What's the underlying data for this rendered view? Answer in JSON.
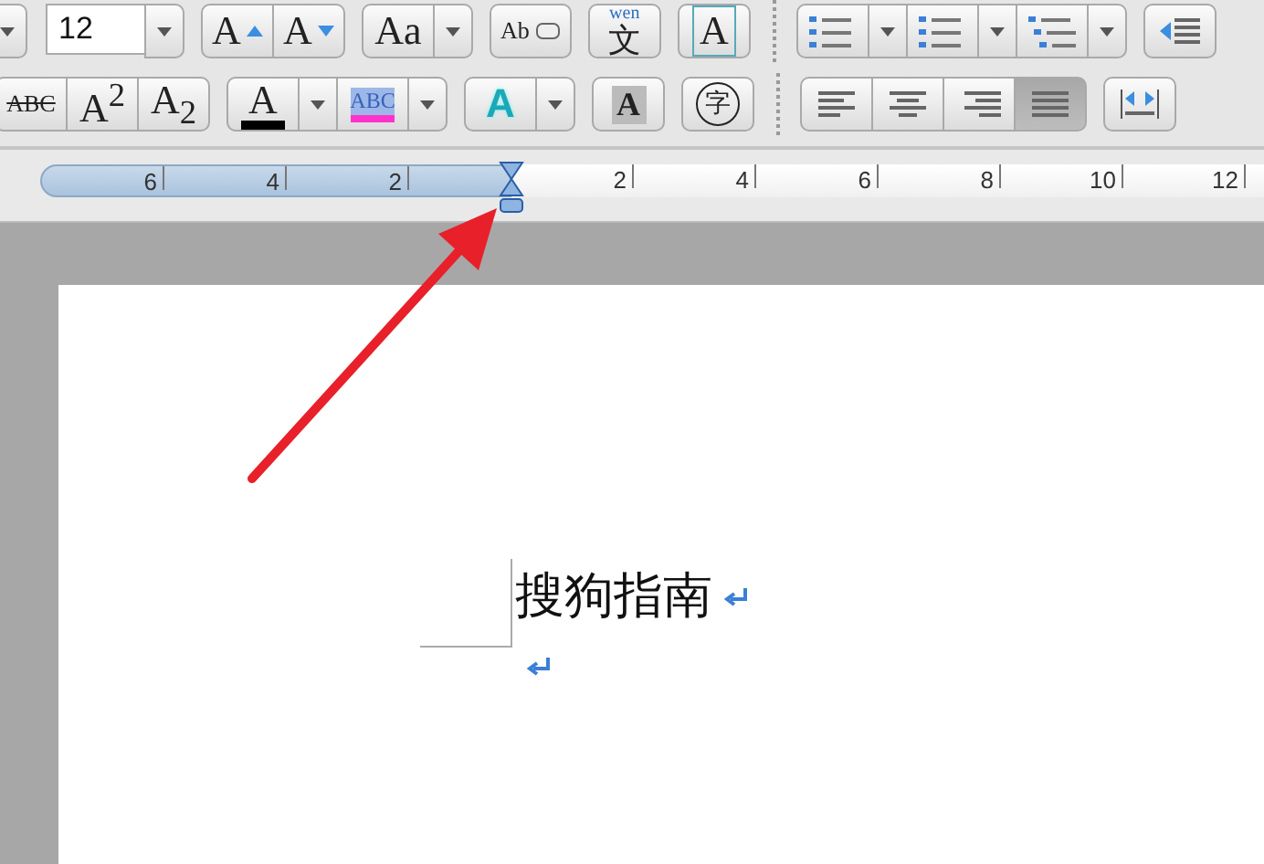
{
  "toolbar": {
    "rows": [
      {
        "groups": [
          {
            "items": [
              {
                "kind": "caret"
              }
            ]
          },
          {
            "items": [
              {
                "kind": "field",
                "value": "12"
              },
              {
                "kind": "caret"
              }
            ]
          },
          {
            "items": [
              {
                "kind": "grow",
                "label": "A"
              },
              {
                "kind": "shrink",
                "label": "A"
              }
            ]
          },
          {
            "items": [
              {
                "kind": "glyph",
                "label": "Aa"
              },
              {
                "kind": "caret"
              }
            ]
          },
          {
            "items": [
              {
                "kind": "eraser",
                "label": "Ab"
              }
            ]
          },
          {
            "items": [
              {
                "kind": "ruby",
                "top": "wen",
                "label": "文"
              }
            ]
          },
          {
            "items": [
              {
                "kind": "boxed",
                "label": "A"
              }
            ]
          },
          {
            "kind": "separator"
          },
          {
            "items": [
              {
                "kind": "bullets"
              },
              {
                "kind": "caret"
              },
              {
                "kind": "numbers"
              },
              {
                "kind": "caret"
              },
              {
                "kind": "outline"
              },
              {
                "kind": "caret"
              }
            ]
          },
          {
            "items": [
              {
                "kind": "outdent"
              }
            ]
          }
        ]
      },
      {
        "groups": [
          {
            "items": [
              {
                "kind": "strike",
                "label": "ABC"
              },
              {
                "kind": "glyph",
                "label": "A$^{2}$"
              },
              {
                "kind": "glyph",
                "label": "A$_{2}$"
              }
            ]
          },
          {
            "items": [
              {
                "kind": "fontcolor",
                "label": "A",
                "color": "#000000"
              },
              {
                "kind": "caret"
              },
              {
                "kind": "highlight",
                "label": "ABC",
                "color": "#ff33cc"
              },
              {
                "kind": "caret"
              }
            ]
          },
          {
            "items": [
              {
                "kind": "glow",
                "label": "A"
              },
              {
                "kind": "caret"
              }
            ]
          },
          {
            "items": [
              {
                "kind": "shaded",
                "label": "A"
              }
            ]
          },
          {
            "items": [
              {
                "kind": "circled",
                "label": "字"
              }
            ]
          },
          {
            "kind": "separator"
          },
          {
            "items": [
              {
                "kind": "align-left",
                "selected": false
              },
              {
                "kind": "align-center",
                "selected": false
              },
              {
                "kind": "align-right",
                "selected": false
              },
              {
                "kind": "align-justify",
                "selected": true
              }
            ]
          },
          {
            "items": [
              {
                "kind": "distribute"
              }
            ]
          }
        ]
      }
    ]
  },
  "ruler": {
    "left_labels": [
      "6",
      "4",
      "2"
    ],
    "right_labels": [
      "2",
      "4",
      "6",
      "8",
      "10",
      "12"
    ]
  },
  "document": {
    "paragraphs": [
      {
        "kind": "text",
        "text": "搜狗指南"
      },
      {
        "kind": "empty"
      }
    ]
  }
}
